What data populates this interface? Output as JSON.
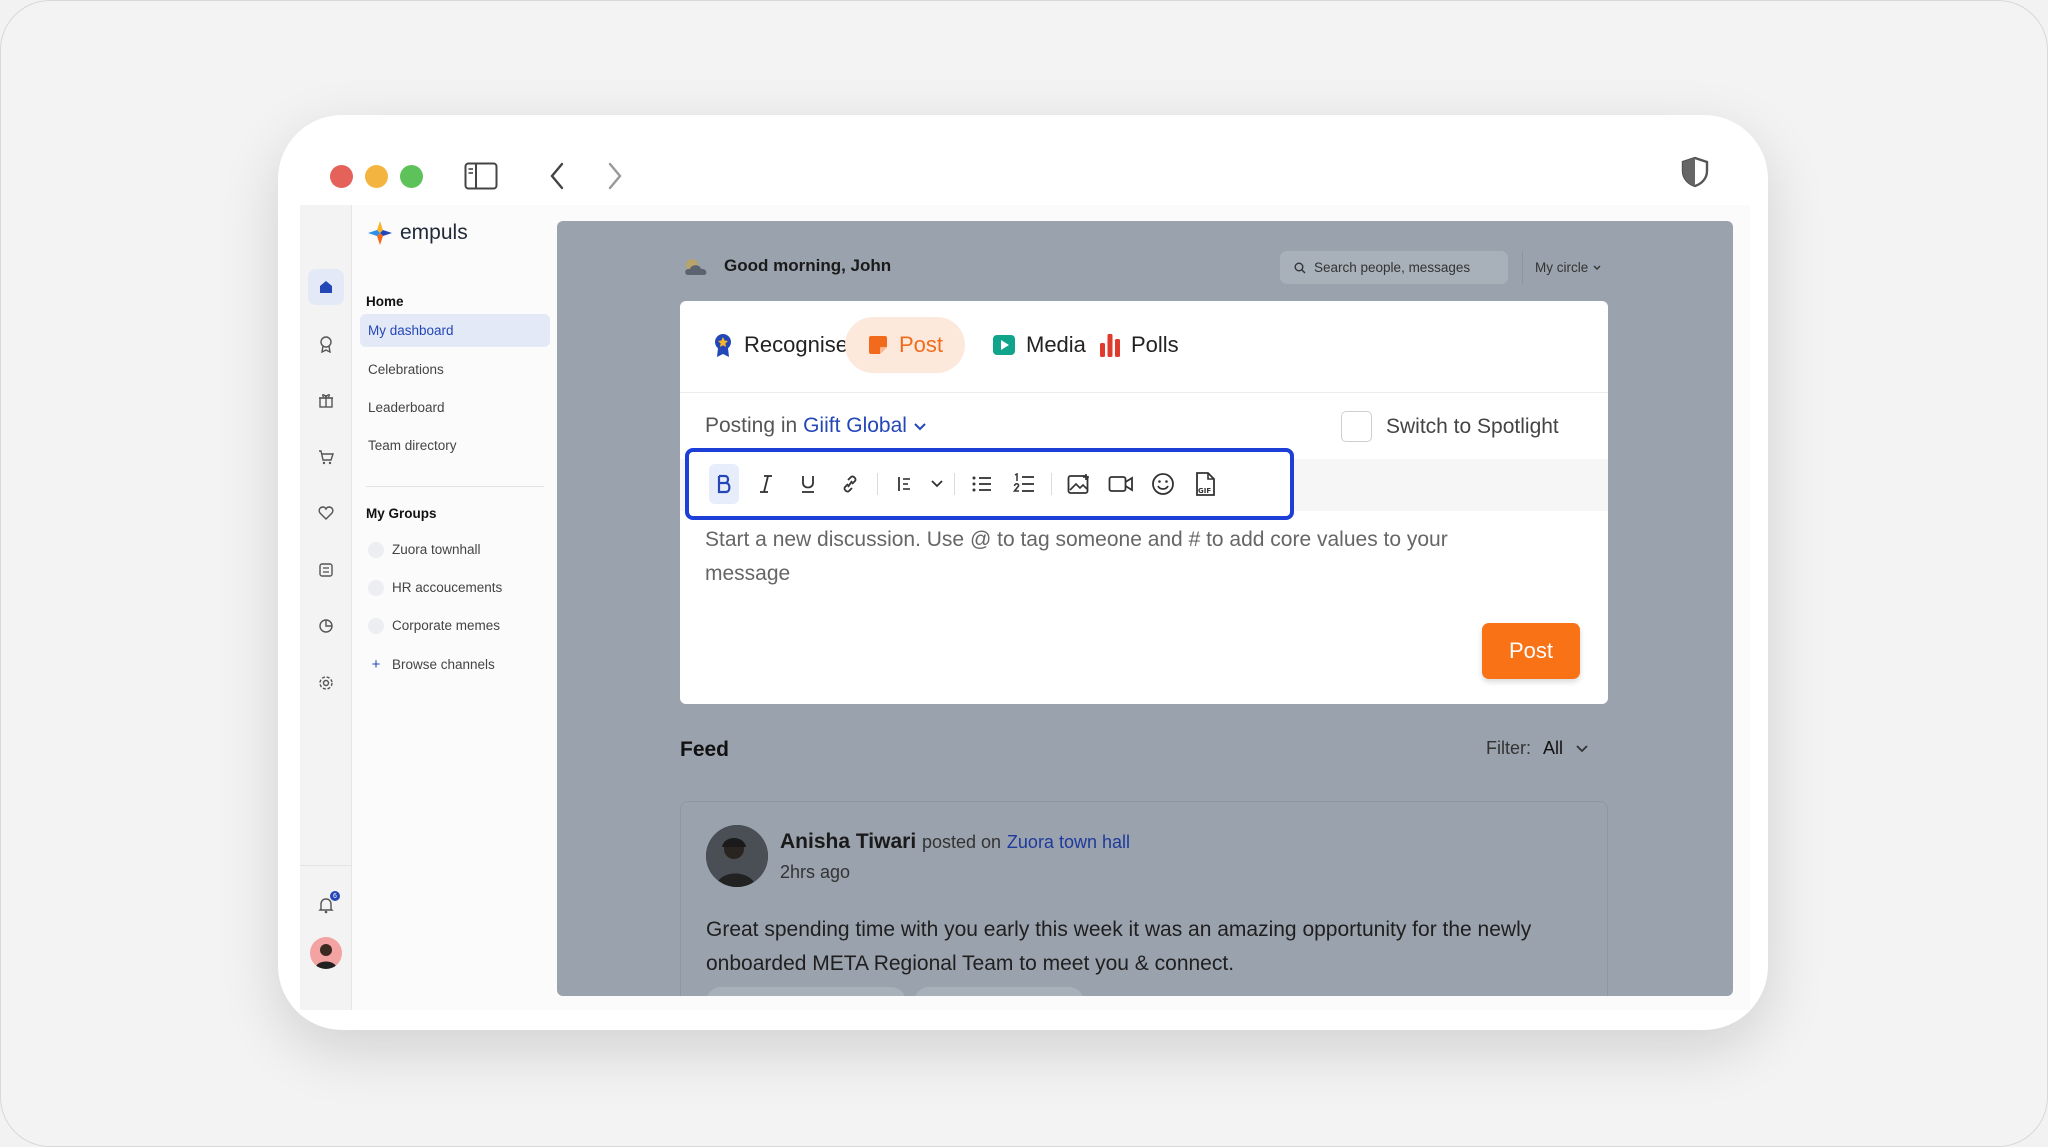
{
  "brand": {
    "name": "empuls"
  },
  "sidebar": {
    "home_title": "Home",
    "home_items": [
      {
        "label": "My dashboard",
        "active": true
      },
      {
        "label": "Celebrations"
      },
      {
        "label": "Leaderboard"
      },
      {
        "label": "Team directory"
      }
    ],
    "groups_title": "My Groups",
    "groups": [
      {
        "label": "Zuora townhall"
      },
      {
        "label": "HR accoucements"
      },
      {
        "label": "Corporate memes"
      }
    ],
    "browse_label": "Browse channels"
  },
  "rail": {
    "icons": [
      "home-icon",
      "award-icon",
      "gift-icon",
      "cart-icon",
      "heart-icon",
      "survey-icon",
      "analytics-icon",
      "settings-icon"
    ],
    "notification_count": "6"
  },
  "header": {
    "greeting": "Good morning, John",
    "search_placeholder": "Search people, messages",
    "circle_label": "My circle"
  },
  "composer": {
    "tabs": [
      {
        "label": "Recognise",
        "icon": "badge-icon"
      },
      {
        "label": "Post",
        "icon": "post-icon",
        "active": true
      },
      {
        "label": "Media",
        "icon": "media-icon"
      },
      {
        "label": "Polls",
        "icon": "polls-icon"
      }
    ],
    "posting_prefix": "Posting in",
    "posting_group": "Giift Global",
    "spotlight_label": "Switch to Spotlight",
    "toolbar": [
      "bold-icon",
      "italic-icon",
      "underline-icon",
      "link-icon",
      "align-icon",
      "bullet-list-icon",
      "numbered-list-icon",
      "image-icon",
      "video-icon",
      "emoji-icon",
      "gif-icon"
    ],
    "placeholder": "Start a new discussion. Use @ to tag someone and # to add core values to your message",
    "post_label": "Post"
  },
  "feed": {
    "title": "Feed",
    "filter_label": "Filter:",
    "filter_value": "All",
    "posts": [
      {
        "author": "Anisha Tiwari",
        "verb": "posted on",
        "channel": "Zuora town hall",
        "time": "2hrs ago",
        "body": "Great spending time with you early this week it was an amazing opportunity for the newly onboarded META Regional Team to meet you & connect."
      }
    ]
  },
  "colors": {
    "accent": "#f97316",
    "brand_blue": "#2447b8",
    "highlight": "#1d3fd8",
    "overlay": "#9aa2ad"
  }
}
